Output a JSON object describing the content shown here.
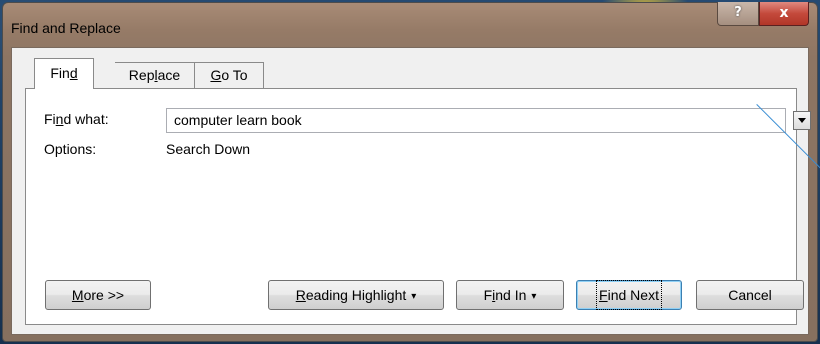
{
  "window": {
    "title": "Find and Replace",
    "help_glyph": "?",
    "close_glyph": "x"
  },
  "tabs": [
    {
      "label_pre": "Fin",
      "label_ul": "d",
      "label_post": "",
      "active": true
    },
    {
      "label_pre": "Rep",
      "label_ul": "l",
      "label_post": "ace",
      "active": false
    },
    {
      "label_pre": "",
      "label_ul": "G",
      "label_post": "o To",
      "active": false
    }
  ],
  "find": {
    "label_pre": "Fi",
    "label_ul": "n",
    "label_post": "d what:",
    "value": "computer learn book"
  },
  "options": {
    "label": "Options:",
    "value": "Search Down"
  },
  "buttons": {
    "more": {
      "ul": "M",
      "rest": "ore >>"
    },
    "reading_highlight": {
      "ul": "R",
      "rest": "eading Highlight",
      "caret": "▾"
    },
    "find_in": {
      "pre": "F",
      "ul": "i",
      "rest": "nd In",
      "caret": "▾"
    },
    "find_next": {
      "ul": "F",
      "rest": "ind Next"
    },
    "cancel": {
      "label": "Cancel"
    }
  },
  "colors": {
    "accent": "#3c7fb1",
    "close_red": "#c44a3c",
    "desktop": "#1f3a5e"
  }
}
